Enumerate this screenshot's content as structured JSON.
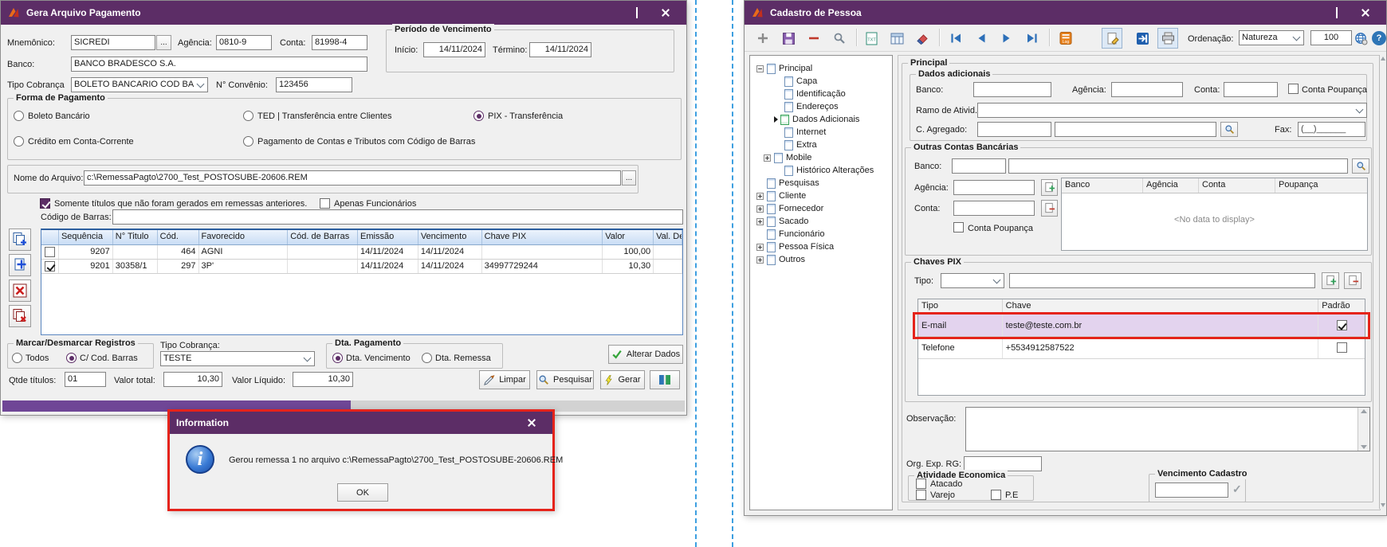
{
  "annotations": {
    "highlight_color": "#e5231b",
    "divider_color": "#3d9fe0"
  },
  "ga": {
    "title": "Gera Arquivo Pagamento",
    "mnemonico_label": "Mnemônico:",
    "mnemonico": "SICREDI",
    "browse": "...",
    "agencia_label": "Agência:",
    "agencia": "0810-9",
    "conta_label": "Conta:",
    "conta": "81998-4",
    "banco_label": "Banco:",
    "banco": "BANCO BRADESCO S.A.",
    "tipo_cobranca_label": "Tipo Cobrança",
    "tipo_cobranca": "BOLETO BANCARIO COD BA",
    "convenio_label": "N° Convênio:",
    "convenio": "123456",
    "periodo": {
      "title": "Período de Vencimento",
      "inicio_label": "Início:",
      "inicio": "14/11/2024",
      "termino_label": "Término:",
      "termino": "14/11/2024"
    },
    "forma": {
      "title": "Forma de Pagamento",
      "boleto": "Boleto Bancário",
      "ted": "TED | Transferência entre Clientes",
      "pix": "PIX - Transferência",
      "credito": "Crédito em Conta-Corrente",
      "tributos": "Pagamento de Contas e Tributos com Código de Barras",
      "selected": "PIX - Transferência"
    },
    "arquivo_label": "Nome do Arquivo:",
    "arquivo": "c:\\RemessaPagto\\2700_Test_POSTOSUBE-20606.REM",
    "chk_somente": "Somente títulos que não foram gerados em remessas anteriores.",
    "chk_somente_checked": true,
    "chk_funcionarios": "Apenas Funcionários",
    "chk_funcionarios_checked": false,
    "codigo_barras_label": "Código de Barras:",
    "codigo_barras": "",
    "grid": {
      "columns": {
        "sequencia": "Sequência",
        "n_titulo": "N° Titulo",
        "cod": "Cód.",
        "favorecido": "Favorecido",
        "cod_barras": "Cód. de Barras",
        "emissao": "Emissão",
        "vencimento": "Vencimento",
        "chave_pix": "Chave PIX",
        "valor": "Valor",
        "val_desco": "Val. Desco"
      },
      "rows": [
        {
          "checked": false,
          "sequencia": "9207",
          "n_titulo": "",
          "cod": "464",
          "favorecido": "AGNI",
          "cod_barras": "",
          "emissao": "14/11/2024",
          "vencimento": "14/11/2024",
          "chave_pix": "",
          "valor": "100,00",
          "val_desco": ""
        },
        {
          "checked": true,
          "sequencia": "9201",
          "n_titulo": "30358/1",
          "cod": "297",
          "favorecido": "3P'",
          "cod_barras": "",
          "emissao": "14/11/2024",
          "vencimento": "14/11/2024",
          "chave_pix": "34997729244",
          "valor": "10,30",
          "val_desco": ""
        }
      ]
    },
    "marcar": {
      "title": "Marcar/Desmarcar Registros",
      "todos": "Todos",
      "cod_barras": "C/ Cod. Barras",
      "selected": "C/ Cod. Barras"
    },
    "tipo_cobranca2_label": "Tipo Cobrança:",
    "tipo_cobranca2": "TESTE",
    "dta": {
      "title": "Dta. Pagamento",
      "vencimento": "Dta. Vencimento",
      "remessa": "Dta. Remessa",
      "selected": "Dta. Vencimento"
    },
    "alterar_dados": "Alterar Dados",
    "qtde_label": "Qtde títulos:",
    "qtde": "01",
    "valor_total_label": "Valor total:",
    "valor_total": "10,30",
    "valor_liquido_label": "Valor Líquido:",
    "valor_liquido": "10,30",
    "limpar": "Limpar",
    "pesquisar": "Pesquisar",
    "gerar": "Gerar",
    "progress_percent": 51
  },
  "dialog": {
    "title": "Information",
    "message": "Gerou remessa 1 no arquivo c:\\RemessaPagto\\2700_Test_POSTOSUBE-20606.REM",
    "ok": "OK"
  },
  "cp": {
    "title": "Cadastro de Pessoa",
    "toolbar": {
      "ordenacao_label": "Ordenação:",
      "ordenacao": "Natureza",
      "page_size": "100",
      "log_text": "Log",
      "txt_text": "TXT"
    },
    "tree": {
      "items": [
        {
          "label": "Principal",
          "level": 0,
          "expand": "minus",
          "selected": false
        },
        {
          "label": "Capa",
          "level": 1,
          "expand": "none",
          "selected": false
        },
        {
          "label": "Identificação",
          "level": 1,
          "expand": "none",
          "selected": false
        },
        {
          "label": "Endereços",
          "level": 1,
          "expand": "none",
          "selected": false
        },
        {
          "label": "Dados Adicionais",
          "level": 1,
          "expand": "none",
          "selected": true
        },
        {
          "label": "Internet",
          "level": 1,
          "expand": "none",
          "selected": false
        },
        {
          "label": "Extra",
          "level": 1,
          "expand": "none",
          "selected": false
        },
        {
          "label": "Mobile",
          "level": 1,
          "expand": "plus",
          "selected": false
        },
        {
          "label": "Histórico Alterações",
          "level": 1,
          "expand": "none",
          "selected": false
        },
        {
          "label": "Pesquisas",
          "level": 0,
          "expand": "none",
          "selected": false
        },
        {
          "label": "Cliente",
          "level": 0,
          "expand": "plus",
          "selected": false
        },
        {
          "label": "Fornecedor",
          "level": 0,
          "expand": "plus",
          "selected": false
        },
        {
          "label": "Sacado",
          "level": 0,
          "expand": "plus",
          "selected": false
        },
        {
          "label": "Funcionário",
          "level": 0,
          "expand": "none",
          "selected": false
        },
        {
          "label": "Pessoa Física",
          "level": 0,
          "expand": "plus",
          "selected": false
        },
        {
          "label": "Outros",
          "level": 0,
          "expand": "plus",
          "selected": false
        }
      ]
    },
    "principal_title": "Principal",
    "dados": {
      "title": "Dados adicionais",
      "banco_label": "Banco:",
      "agencia_label": "Agência:",
      "conta_label": "Conta:",
      "conta_poupanca": "Conta Poupança",
      "ramo_label": "Ramo de Ativid.",
      "agregado_label": "C. Agregado:",
      "fax_label": "Fax:",
      "fax_mask": "(__)______"
    },
    "outras": {
      "title": "Outras Contas Bancárias",
      "banco_label": "Banco:",
      "agencia_label": "Agência:",
      "conta_label": "Conta:",
      "conta_poupanca": "Conta Poupança",
      "col_banco": "Banco",
      "col_agencia": "Agência",
      "col_conta": "Conta",
      "col_poupanca": "Poupança",
      "empty": "<No data to display>"
    },
    "pix": {
      "title": "Chaves PIX",
      "tipo_label": "Tipo:",
      "col_tipo": "Tipo",
      "col_chave": "Chave",
      "col_padrao": "Padrão",
      "rows": [
        {
          "tipo": "E-mail",
          "chave": "teste@teste.com.br",
          "padrao": true,
          "highlighted": true
        },
        {
          "tipo": "Telefone",
          "chave": "+5534912587522",
          "padrao": false,
          "highlighted": false
        }
      ]
    },
    "observacao_label": "Observação:",
    "org_exp_rg_label": "Org. Exp. RG:",
    "atividade": {
      "title": "Atividade Economica",
      "atacado": "Atacado",
      "varejo": "Varejo",
      "pe": "P.E"
    },
    "vencimento_title": "Vencimento Cadastro"
  }
}
